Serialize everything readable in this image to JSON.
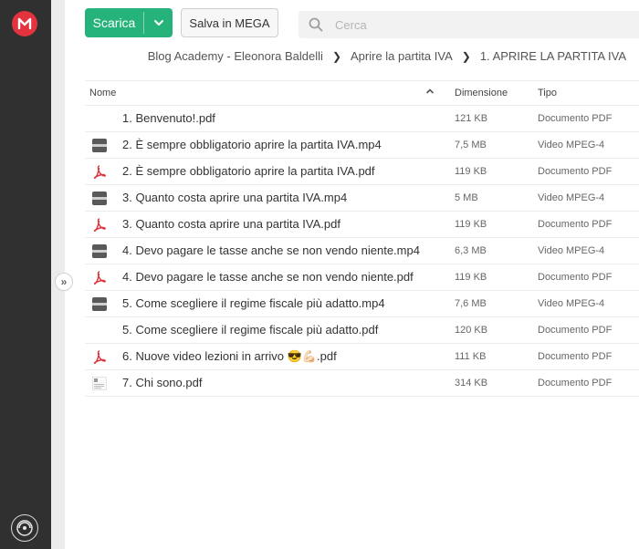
{
  "app": {
    "brand_color": "#e3333e",
    "accent_color": "#26b37b"
  },
  "toolbar": {
    "download_label": "Scarica",
    "save_label": "Salva in MEGA",
    "search_placeholder": "Cerca"
  },
  "breadcrumb": [
    "Blog Academy - Eleonora Baldelli",
    "Aprire la partita IVA",
    "1. APRIRE LA PARTITA IVA"
  ],
  "table": {
    "columns": {
      "name": "Nome",
      "size": "Dimensione",
      "type": "Tipo"
    },
    "sort": "name-ascending",
    "rows": [
      {
        "icon": "none",
        "name": "1. Benvenuto!.pdf",
        "size": "121 KB",
        "type": "Documento PDF"
      },
      {
        "icon": "video-file-icon",
        "name": "2. È sempre obbligatorio aprire la partita IVA.mp4",
        "size": "7,5 MB",
        "type": "Video MPEG-4"
      },
      {
        "icon": "pdf-file-icon",
        "name": "2. È sempre obbligatorio aprire la partita IVA.pdf",
        "size": "119 KB",
        "type": "Documento PDF"
      },
      {
        "icon": "video-file-icon",
        "name": "3. Quanto costa aprire una partita IVA.mp4",
        "size": "5 MB",
        "type": "Video MPEG-4"
      },
      {
        "icon": "pdf-file-icon",
        "name": "3. Quanto costa aprire una partita IVA.pdf",
        "size": "119 KB",
        "type": "Documento PDF"
      },
      {
        "icon": "video-file-icon",
        "name": "4. Devo pagare le tasse anche se non vendo niente.mp4",
        "size": "6,3 MB",
        "type": "Video MPEG-4"
      },
      {
        "icon": "pdf-file-icon",
        "name": "4. Devo pagare le tasse anche se non vendo niente.pdf",
        "size": "119 KB",
        "type": "Documento PDF"
      },
      {
        "icon": "video-file-icon",
        "name": "5. Come scegliere il regime fiscale più adatto.mp4",
        "size": "7,6 MB",
        "type": "Video MPEG-4"
      },
      {
        "icon": "none",
        "name": "5. Come scegliere il regime fiscale più adatto.pdf",
        "size": "120 KB",
        "type": "Documento PDF"
      },
      {
        "icon": "pdf-file-icon",
        "name": "6. Nuove video lezioni in arrivo 😎💪🏻.pdf",
        "size": "111 KB",
        "type": "Documento PDF"
      },
      {
        "icon": "document-thumbnail-icon",
        "name": "7. Chi sono.pdf",
        "size": "314 KB",
        "type": "Documento PDF"
      }
    ]
  }
}
